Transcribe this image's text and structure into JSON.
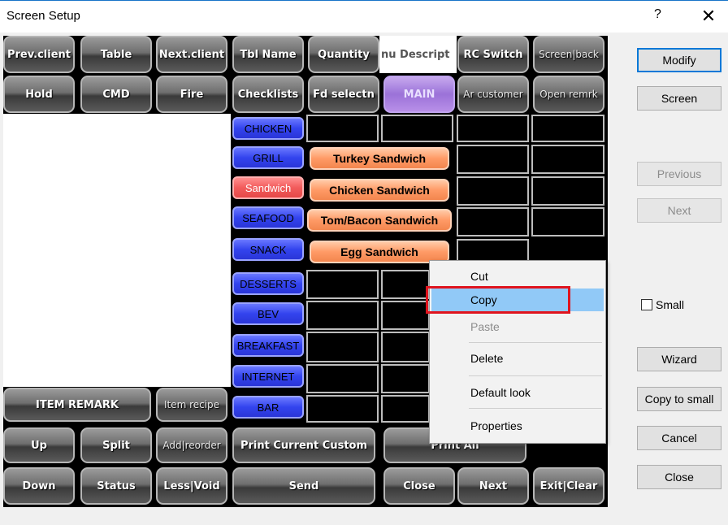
{
  "window": {
    "title": "Screen Setup",
    "help_glyph": "?",
    "close_glyph": "✕"
  },
  "top_row1": [
    "Prev.client",
    "Table",
    "Next.client",
    "Tbl Name",
    "Quantity",
    "nu Descript",
    "RC Switch",
    "Screen|back"
  ],
  "top_row2": [
    "Hold",
    "CMD",
    "Fire",
    "Checklists",
    "Fd selectn",
    "MAIN",
    "Ar customer",
    "Open remrk"
  ],
  "categories": [
    "CHICKEN",
    "GRILL",
    "Sandwich",
    "SEAFOOD",
    "SNACK",
    "DESSERTS",
    "BEV",
    "BREAKFAST",
    "INTERNET",
    "BAR"
  ],
  "menu_items": [
    "Turkey Sandwich",
    "Chicken Sandwich",
    "Tom/Bacon Sandwich",
    "Egg Sandwich"
  ],
  "side_buttons": [
    "ITEM REMARK",
    "Item recipe"
  ],
  "bottom_row1": [
    "Up",
    "Split",
    "Add|reorder",
    "Print Current Custom",
    "Print All"
  ],
  "bottom_row2": [
    "Down",
    "Status",
    "Less|Void",
    "Send",
    "Close",
    "Next",
    "Exit|Clear"
  ],
  "right_panel": {
    "modify": "Modify",
    "screen": "Screen",
    "previous": "Previous",
    "next": "Next",
    "small_label": "Small",
    "small_checked": false,
    "wizard": "Wizard",
    "copy_to_small": "Copy to small",
    "cancel": "Cancel",
    "close": "Close"
  },
  "context_menu": {
    "items": [
      "Cut",
      "Copy",
      "Paste",
      "Delete",
      "Default look",
      "Properties"
    ],
    "hovered": "Copy",
    "disabled": [
      "Paste"
    ]
  },
  "colors": {
    "category_blue": "#3344ee",
    "category_active": "#f25c5c",
    "menu_orange": "#ff9a66",
    "highlight_red": "#e0141e",
    "menu_hover": "#91c9f7"
  }
}
